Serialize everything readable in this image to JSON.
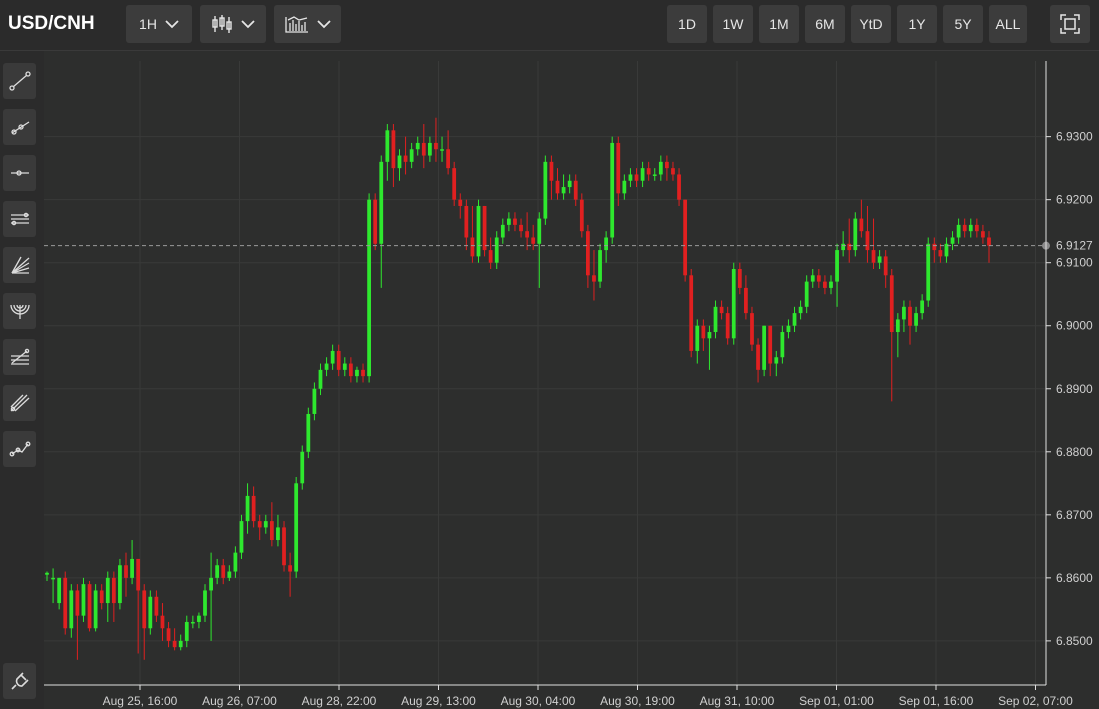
{
  "symbol": "USD/CNH",
  "interval": {
    "label": "1H"
  },
  "ranges": [
    "1D",
    "1W",
    "1M",
    "6M",
    "YtD",
    "1Y",
    "5Y",
    "ALL"
  ],
  "icons": {
    "chart_type": "candlestick-icon",
    "indicators": "indicators-icon",
    "fullscreen": "fullscreen-icon",
    "magnet": "magnet-icon",
    "tools": [
      "trend-line-icon",
      "ray-icon",
      "horizontal-line-icon",
      "parallel-channel-icon",
      "fib-fan-icon",
      "fib-arc-icon",
      "fib-retracement-icon",
      "pitchfork-icon",
      "path-icon"
    ]
  },
  "colors": {
    "up": "#2ee82e",
    "down": "#e02020",
    "background": "#2d2e2d",
    "last_price_marker": "#9a9a9a"
  },
  "chart_data": {
    "type": "candlestick",
    "title": "",
    "xlabel": "",
    "ylabel": "",
    "ylim": [
      6.843,
      6.942
    ],
    "y_ticks": [
      "6.9300",
      "6.9200",
      "6.9100",
      "6.9000",
      "6.8900",
      "6.8800",
      "6.8700",
      "6.8600",
      "6.8500"
    ],
    "x_ticks": [
      "Aug 25, 16:00",
      "Aug 26, 07:00",
      "Aug 28, 22:00",
      "Aug 29, 13:00",
      "Aug 30, 04:00",
      "Aug 30, 19:00",
      "Aug 31, 10:00",
      "Sep 01, 01:00",
      "Sep 01, 16:00",
      "Sep 02, 07:00"
    ],
    "last_price": "6.9127",
    "grid": true,
    "candles": [
      [
        6.8605,
        6.8608,
        6.8595,
        6.861
      ],
      [
        6.86,
        6.86,
        6.856,
        6.8615
      ],
      [
        6.856,
        6.86,
        6.855,
        6.86
      ],
      [
        6.86,
        6.852,
        6.851,
        6.861
      ],
      [
        6.852,
        6.858,
        6.8505,
        6.859
      ],
      [
        6.858,
        6.854,
        6.847,
        6.859
      ],
      [
        6.854,
        6.859,
        6.853,
        6.86
      ],
      [
        6.859,
        6.852,
        6.8515,
        6.8595
      ],
      [
        6.852,
        6.858,
        6.8515,
        6.859
      ],
      [
        6.858,
        6.856,
        6.855,
        6.859
      ],
      [
        6.856,
        6.86,
        6.853,
        6.861
      ],
      [
        6.86,
        6.856,
        6.853,
        6.861
      ],
      [
        6.856,
        6.862,
        6.855,
        6.863
      ],
      [
        6.862,
        6.86,
        6.857,
        6.864
      ],
      [
        6.86,
        6.863,
        6.859,
        6.866
      ],
      [
        6.863,
        6.858,
        6.848,
        6.863
      ],
      [
        6.858,
        6.852,
        6.847,
        6.859
      ],
      [
        6.852,
        6.857,
        6.851,
        6.858
      ],
      [
        6.857,
        6.854,
        6.853,
        6.858
      ],
      [
        6.854,
        6.852,
        6.85,
        6.856
      ],
      [
        6.852,
        6.85,
        6.849,
        6.853
      ],
      [
        6.85,
        6.849,
        6.8485,
        6.852
      ],
      [
        6.849,
        6.85,
        6.8485,
        6.851
      ],
      [
        6.85,
        6.853,
        6.849,
        6.854
      ],
      [
        6.853,
        6.853,
        6.852,
        6.854
      ],
      [
        6.853,
        6.854,
        6.852,
        6.8545
      ],
      [
        6.854,
        6.858,
        6.853,
        6.859
      ],
      [
        6.858,
        6.86,
        6.85,
        6.864
      ],
      [
        6.86,
        6.862,
        6.859,
        6.863
      ],
      [
        6.862,
        6.86,
        6.859,
        6.863
      ],
      [
        6.86,
        6.861,
        6.8595,
        6.862
      ],
      [
        6.861,
        6.864,
        6.86,
        6.865
      ],
      [
        6.864,
        6.869,
        6.863,
        6.87
      ],
      [
        6.869,
        6.873,
        6.867,
        6.875
      ],
      [
        6.873,
        6.869,
        6.868,
        6.8745
      ],
      [
        6.869,
        6.868,
        6.866,
        6.87
      ],
      [
        6.868,
        6.869,
        6.867,
        6.87
      ],
      [
        6.869,
        6.866,
        6.865,
        6.872
      ],
      [
        6.866,
        6.868,
        6.865,
        6.87
      ],
      [
        6.868,
        6.862,
        6.861,
        6.869
      ],
      [
        6.862,
        6.861,
        6.857,
        6.864
      ],
      [
        6.861,
        6.875,
        6.86,
        6.876
      ],
      [
        6.875,
        6.88,
        6.874,
        6.881
      ],
      [
        6.88,
        6.886,
        6.879,
        6.887
      ],
      [
        6.886,
        6.89,
        6.885,
        6.891
      ],
      [
        6.89,
        6.893,
        6.889,
        6.894
      ],
      [
        6.893,
        6.894,
        6.892,
        6.895
      ],
      [
        6.894,
        6.896,
        6.893,
        6.897
      ],
      [
        6.896,
        6.893,
        6.892,
        6.897
      ],
      [
        6.893,
        6.894,
        6.892,
        6.895
      ],
      [
        6.894,
        6.892,
        6.891,
        6.895
      ],
      [
        6.892,
        6.893,
        6.891,
        6.8935
      ],
      [
        6.893,
        6.892,
        6.891,
        6.894
      ],
      [
        6.892,
        6.92,
        6.891,
        6.921
      ],
      [
        6.92,
        6.913,
        6.912,
        6.921
      ],
      [
        6.913,
        6.926,
        6.906,
        6.927
      ],
      [
        6.926,
        6.931,
        6.923,
        6.932
      ],
      [
        6.931,
        6.925,
        6.922,
        6.932
      ],
      [
        6.925,
        6.927,
        6.923,
        6.928
      ],
      [
        6.927,
        6.926,
        6.924,
        6.93
      ],
      [
        6.926,
        6.928,
        6.925,
        6.929
      ],
      [
        6.928,
        6.929,
        6.927,
        6.93
      ],
      [
        6.929,
        6.927,
        6.925,
        6.932
      ],
      [
        6.927,
        6.929,
        6.926,
        6.93
      ],
      [
        6.929,
        6.928,
        6.926,
        6.933
      ],
      [
        6.928,
        6.928,
        6.926,
        6.93
      ],
      [
        6.928,
        6.925,
        6.924,
        6.931
      ],
      [
        6.925,
        6.92,
        6.919,
        6.926
      ],
      [
        6.92,
        6.919,
        6.917,
        6.921
      ],
      [
        6.919,
        6.914,
        6.912,
        6.92
      ],
      [
        6.914,
        6.911,
        6.91,
        6.919
      ],
      [
        6.911,
        6.919,
        6.91,
        6.92
      ],
      [
        6.919,
        6.912,
        6.911,
        6.919
      ],
      [
        6.912,
        6.91,
        6.909,
        6.914
      ],
      [
        6.91,
        6.914,
        6.909,
        6.915
      ],
      [
        6.914,
        6.916,
        6.913,
        6.917
      ],
      [
        6.916,
        6.917,
        6.915,
        6.918
      ],
      [
        6.917,
        6.916,
        6.915,
        6.918
      ],
      [
        6.916,
        6.915,
        6.914,
        6.917
      ],
      [
        6.915,
        6.914,
        6.912,
        6.918
      ],
      [
        6.914,
        6.913,
        6.912,
        6.916
      ],
      [
        6.913,
        6.917,
        6.906,
        6.918
      ],
      [
        6.917,
        6.926,
        6.916,
        6.927
      ],
      [
        6.926,
        6.923,
        6.92,
        6.927
      ],
      [
        6.923,
        6.921,
        6.92,
        6.925
      ],
      [
        6.921,
        6.922,
        6.92,
        6.924
      ],
      [
        6.922,
        6.923,
        6.921,
        6.924
      ],
      [
        6.923,
        6.92,
        6.919,
        6.924
      ],
      [
        6.92,
        6.915,
        6.914,
        6.921
      ],
      [
        6.915,
        6.908,
        6.906,
        6.916
      ],
      [
        6.908,
        6.907,
        6.904,
        6.912
      ],
      [
        6.907,
        6.912,
        6.906,
        6.913
      ],
      [
        6.912,
        6.914,
        6.91,
        6.915
      ],
      [
        6.914,
        6.929,
        6.913,
        6.93
      ],
      [
        6.929,
        6.921,
        6.919,
        6.93
      ],
      [
        6.921,
        6.923,
        6.92,
        6.924
      ],
      [
        6.923,
        6.924,
        6.922,
        6.925
      ],
      [
        6.924,
        6.923,
        6.922,
        6.925
      ],
      [
        6.923,
        6.925,
        6.922,
        6.926
      ],
      [
        6.925,
        6.924,
        6.923,
        6.926
      ],
      [
        6.924,
        6.924,
        6.923,
        6.925
      ],
      [
        6.924,
        6.926,
        6.923,
        6.927
      ],
      [
        6.926,
        6.925,
        6.923,
        6.927
      ],
      [
        6.925,
        6.924,
        6.923,
        6.926
      ],
      [
        6.924,
        6.92,
        6.919,
        6.925
      ],
      [
        6.92,
        6.908,
        6.907,
        6.92
      ],
      [
        6.908,
        6.896,
        6.895,
        6.909
      ],
      [
        6.896,
        6.9,
        6.894,
        6.901
      ],
      [
        6.9,
        6.898,
        6.896,
        6.901
      ],
      [
        6.898,
        6.899,
        6.893,
        6.9
      ],
      [
        6.899,
        6.903,
        6.898,
        6.904
      ],
      [
        6.903,
        6.902,
        6.901,
        6.904
      ],
      [
        6.902,
        6.898,
        6.897,
        6.903
      ],
      [
        6.898,
        6.909,
        6.897,
        6.91
      ],
      [
        6.909,
        6.906,
        6.905,
        6.91
      ],
      [
        6.906,
        6.902,
        6.901,
        6.908
      ],
      [
        6.902,
        6.897,
        6.896,
        6.903
      ],
      [
        6.897,
        6.893,
        6.891,
        6.898
      ],
      [
        6.893,
        6.9,
        6.892,
        6.9
      ],
      [
        6.9,
        6.894,
        6.892,
        6.9
      ],
      [
        6.894,
        6.895,
        6.892,
        6.896
      ],
      [
        6.895,
        6.899,
        6.894,
        6.9
      ],
      [
        6.899,
        6.9,
        6.898,
        6.901
      ],
      [
        6.9,
        6.902,
        6.899,
        6.903
      ],
      [
        6.902,
        6.903,
        6.901,
        6.904
      ],
      [
        6.903,
        6.907,
        6.902,
        6.908
      ],
      [
        6.907,
        6.908,
        6.906,
        6.909
      ],
      [
        6.908,
        6.907,
        6.906,
        6.909
      ],
      [
        6.907,
        6.906,
        6.905,
        6.908
      ],
      [
        6.906,
        6.907,
        6.905,
        6.908
      ],
      [
        6.907,
        6.912,
        6.903,
        6.913
      ],
      [
        6.912,
        6.913,
        6.911,
        6.915
      ],
      [
        6.913,
        6.912,
        6.91,
        6.917
      ],
      [
        6.912,
        6.917,
        6.911,
        6.918
      ],
      [
        6.917,
        6.915,
        6.914,
        6.92
      ],
      [
        6.915,
        6.912,
        6.91,
        6.919
      ],
      [
        6.912,
        6.91,
        6.909,
        6.917
      ],
      [
        6.91,
        6.911,
        6.909,
        6.912
      ],
      [
        6.911,
        6.908,
        6.906,
        6.912
      ],
      [
        6.908,
        6.899,
        6.888,
        6.909
      ],
      [
        6.899,
        6.901,
        6.895,
        6.902
      ],
      [
        6.901,
        6.903,
        6.899,
        6.904
      ],
      [
        6.903,
        6.9,
        6.897,
        6.904
      ],
      [
        6.9,
        6.902,
        6.899,
        6.903
      ],
      [
        6.902,
        6.904,
        6.901,
        6.905
      ],
      [
        6.904,
        6.913,
        6.903,
        6.914
      ],
      [
        6.913,
        6.912,
        6.91,
        6.914
      ],
      [
        6.912,
        6.911,
        6.91,
        6.913
      ],
      [
        6.911,
        6.913,
        6.91,
        6.914
      ],
      [
        6.913,
        6.914,
        6.912,
        6.915
      ],
      [
        6.914,
        6.916,
        6.913,
        6.917
      ],
      [
        6.916,
        6.915,
        6.914,
        6.917
      ],
      [
        6.915,
        6.916,
        6.914,
        6.917
      ],
      [
        6.916,
        6.915,
        6.914,
        6.917
      ],
      [
        6.915,
        6.914,
        6.913,
        6.916
      ],
      [
        6.914,
        6.9127,
        6.91,
        6.915
      ]
    ]
  }
}
